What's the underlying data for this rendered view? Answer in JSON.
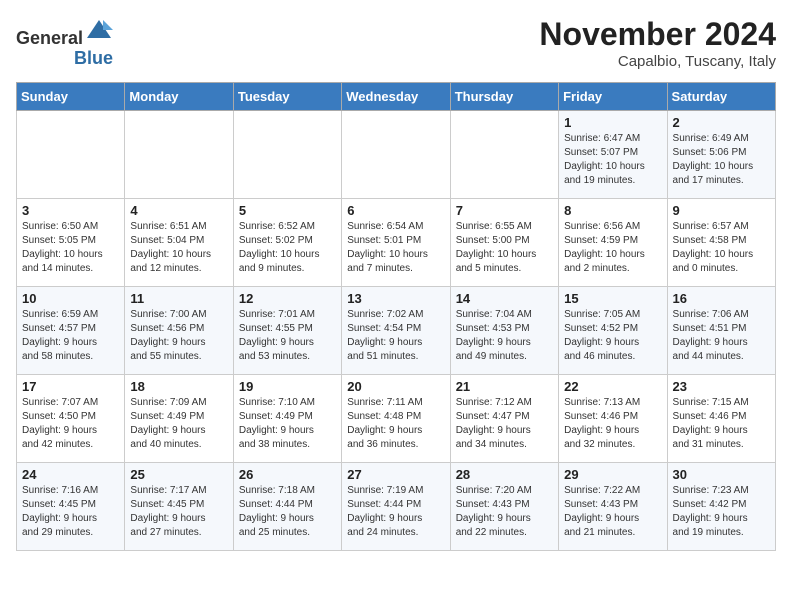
{
  "header": {
    "logo_line1": "General",
    "logo_line2": "Blue",
    "month": "November 2024",
    "location": "Capalbio, Tuscany, Italy"
  },
  "weekdays": [
    "Sunday",
    "Monday",
    "Tuesday",
    "Wednesday",
    "Thursday",
    "Friday",
    "Saturday"
  ],
  "weeks": [
    [
      {
        "day": "",
        "info": ""
      },
      {
        "day": "",
        "info": ""
      },
      {
        "day": "",
        "info": ""
      },
      {
        "day": "",
        "info": ""
      },
      {
        "day": "",
        "info": ""
      },
      {
        "day": "1",
        "info": "Sunrise: 6:47 AM\nSunset: 5:07 PM\nDaylight: 10 hours\nand 19 minutes."
      },
      {
        "day": "2",
        "info": "Sunrise: 6:49 AM\nSunset: 5:06 PM\nDaylight: 10 hours\nand 17 minutes."
      }
    ],
    [
      {
        "day": "3",
        "info": "Sunrise: 6:50 AM\nSunset: 5:05 PM\nDaylight: 10 hours\nand 14 minutes."
      },
      {
        "day": "4",
        "info": "Sunrise: 6:51 AM\nSunset: 5:04 PM\nDaylight: 10 hours\nand 12 minutes."
      },
      {
        "day": "5",
        "info": "Sunrise: 6:52 AM\nSunset: 5:02 PM\nDaylight: 10 hours\nand 9 minutes."
      },
      {
        "day": "6",
        "info": "Sunrise: 6:54 AM\nSunset: 5:01 PM\nDaylight: 10 hours\nand 7 minutes."
      },
      {
        "day": "7",
        "info": "Sunrise: 6:55 AM\nSunset: 5:00 PM\nDaylight: 10 hours\nand 5 minutes."
      },
      {
        "day": "8",
        "info": "Sunrise: 6:56 AM\nSunset: 4:59 PM\nDaylight: 10 hours\nand 2 minutes."
      },
      {
        "day": "9",
        "info": "Sunrise: 6:57 AM\nSunset: 4:58 PM\nDaylight: 10 hours\nand 0 minutes."
      }
    ],
    [
      {
        "day": "10",
        "info": "Sunrise: 6:59 AM\nSunset: 4:57 PM\nDaylight: 9 hours\nand 58 minutes."
      },
      {
        "day": "11",
        "info": "Sunrise: 7:00 AM\nSunset: 4:56 PM\nDaylight: 9 hours\nand 55 minutes."
      },
      {
        "day": "12",
        "info": "Sunrise: 7:01 AM\nSunset: 4:55 PM\nDaylight: 9 hours\nand 53 minutes."
      },
      {
        "day": "13",
        "info": "Sunrise: 7:02 AM\nSunset: 4:54 PM\nDaylight: 9 hours\nand 51 minutes."
      },
      {
        "day": "14",
        "info": "Sunrise: 7:04 AM\nSunset: 4:53 PM\nDaylight: 9 hours\nand 49 minutes."
      },
      {
        "day": "15",
        "info": "Sunrise: 7:05 AM\nSunset: 4:52 PM\nDaylight: 9 hours\nand 46 minutes."
      },
      {
        "day": "16",
        "info": "Sunrise: 7:06 AM\nSunset: 4:51 PM\nDaylight: 9 hours\nand 44 minutes."
      }
    ],
    [
      {
        "day": "17",
        "info": "Sunrise: 7:07 AM\nSunset: 4:50 PM\nDaylight: 9 hours\nand 42 minutes."
      },
      {
        "day": "18",
        "info": "Sunrise: 7:09 AM\nSunset: 4:49 PM\nDaylight: 9 hours\nand 40 minutes."
      },
      {
        "day": "19",
        "info": "Sunrise: 7:10 AM\nSunset: 4:49 PM\nDaylight: 9 hours\nand 38 minutes."
      },
      {
        "day": "20",
        "info": "Sunrise: 7:11 AM\nSunset: 4:48 PM\nDaylight: 9 hours\nand 36 minutes."
      },
      {
        "day": "21",
        "info": "Sunrise: 7:12 AM\nSunset: 4:47 PM\nDaylight: 9 hours\nand 34 minutes."
      },
      {
        "day": "22",
        "info": "Sunrise: 7:13 AM\nSunset: 4:46 PM\nDaylight: 9 hours\nand 32 minutes."
      },
      {
        "day": "23",
        "info": "Sunrise: 7:15 AM\nSunset: 4:46 PM\nDaylight: 9 hours\nand 31 minutes."
      }
    ],
    [
      {
        "day": "24",
        "info": "Sunrise: 7:16 AM\nSunset: 4:45 PM\nDaylight: 9 hours\nand 29 minutes."
      },
      {
        "day": "25",
        "info": "Sunrise: 7:17 AM\nSunset: 4:45 PM\nDaylight: 9 hours\nand 27 minutes."
      },
      {
        "day": "26",
        "info": "Sunrise: 7:18 AM\nSunset: 4:44 PM\nDaylight: 9 hours\nand 25 minutes."
      },
      {
        "day": "27",
        "info": "Sunrise: 7:19 AM\nSunset: 4:44 PM\nDaylight: 9 hours\nand 24 minutes."
      },
      {
        "day": "28",
        "info": "Sunrise: 7:20 AM\nSunset: 4:43 PM\nDaylight: 9 hours\nand 22 minutes."
      },
      {
        "day": "29",
        "info": "Sunrise: 7:22 AM\nSunset: 4:43 PM\nDaylight: 9 hours\nand 21 minutes."
      },
      {
        "day": "30",
        "info": "Sunrise: 7:23 AM\nSunset: 4:42 PM\nDaylight: 9 hours\nand 19 minutes."
      }
    ]
  ]
}
